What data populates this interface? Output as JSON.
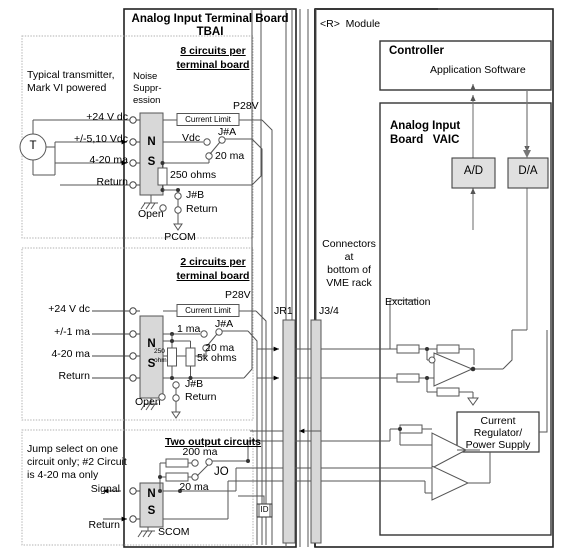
{
  "diagram": {
    "title_tbai_line1": "Analog Input Terminal Board",
    "title_tbai_line2": "TBAI",
    "module_label": "<R>  Module",
    "colors": {
      "line": "#000000",
      "wire": "#555555",
      "block_fill": "#d8d8d8",
      "box_border": "#333333",
      "dashed": "#aaaaaa"
    }
  },
  "sections": {
    "eight_circuit": {
      "heading_line1": "8 circuits per",
      "heading_line2": "terminal board",
      "note_line1": "Typical transmitter,",
      "note_line2": "Mark VI powered",
      "noise_line1": "Noise",
      "noise_line2": "Suppr-",
      "noise_line3": "ession",
      "block_n": "N",
      "block_s": "S",
      "transmitter": "T",
      "terminals": [
        "+24 V dc",
        "+/-5,10 Vdc",
        "4-20 ma",
        "Return"
      ],
      "current_limit": "Current Limit",
      "p28v": "P28V",
      "vdc": "Vdc",
      "jumper_a": "J#A",
      "ma20": "20 ma",
      "resistor": "250 ohms",
      "jumper_b": "J#B",
      "open": "Open",
      "return": "Return",
      "pcom": "PCOM"
    },
    "two_circuit": {
      "heading_line1": "2 circuits per",
      "heading_line2": "terminal board",
      "block_n": "N",
      "block_s": "S",
      "terminals": [
        "+24 V dc",
        "+/-1 ma",
        "4-20 ma",
        "Return"
      ],
      "current_limit": "Current Limit",
      "p28v": "P28V",
      "ma1": "1 ma",
      "jumper_a": "J#A",
      "ma20": "20 ma",
      "resistor_a_line1": "250",
      "resistor_a_line2": "ohm",
      "resistor_b": "5k ohms",
      "jumper_b": "J#B",
      "open": "Open",
      "return": "Return"
    },
    "output_circuits": {
      "heading": "Two output circuits",
      "note_line1": "Jump select on one",
      "note_line2": "circuit only; #2 Circuit",
      "note_line3": "is 4-20 ma only",
      "ma200": "200 ma",
      "jo": "JO",
      "ma20": "20 ma",
      "signal": "Signal",
      "return": "Return",
      "block_n": "N",
      "block_s": "S",
      "scom": "SCOM",
      "id": "ID"
    }
  },
  "connectors": {
    "note_line1": "Connectors",
    "note_line2": "at",
    "note_line3": "bottom of",
    "note_line4": "VME rack",
    "jr1": "JR1",
    "j34": "J3/4"
  },
  "module": {
    "controller_title": "Controller",
    "application_software": "Application Software",
    "board_title_line1": "Analog Input",
    "board_title_line2": "Board   VAIC",
    "ad": "A/D",
    "da": "D/A",
    "excitation": "Excitation",
    "psu_line1": "Current",
    "psu_line2": "Regulator/",
    "psu_line3": "Power Supply"
  }
}
